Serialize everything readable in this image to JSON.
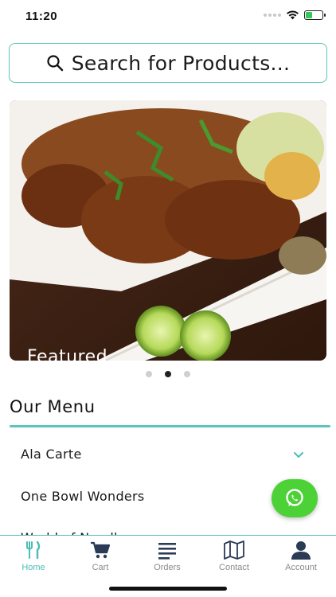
{
  "status_bar": {
    "time": "11:20",
    "battery_level": 0.4
  },
  "search": {
    "placeholder": "Search for Products..."
  },
  "banner": {
    "label": "Featured",
    "slide_count": 3,
    "active_slide": 2
  },
  "menu": {
    "title": "Our Menu",
    "items": [
      {
        "label": "Ala Carte"
      },
      {
        "label": "One Bowl Wonders"
      },
      {
        "label": "World of Noodles"
      }
    ]
  },
  "fab": {
    "icon": "whatsapp-icon",
    "color": "#4cd137"
  },
  "tab_bar": {
    "accent": "#4bbdb4",
    "tabs": [
      {
        "label": "Home",
        "icon": "fork-knife-icon",
        "active": true
      },
      {
        "label": "Cart",
        "icon": "cart-icon",
        "active": false
      },
      {
        "label": "Orders",
        "icon": "list-icon",
        "active": false
      },
      {
        "label": "Contact",
        "icon": "map-icon",
        "active": false
      },
      {
        "label": "Account",
        "icon": "person-icon",
        "active": false
      }
    ]
  }
}
